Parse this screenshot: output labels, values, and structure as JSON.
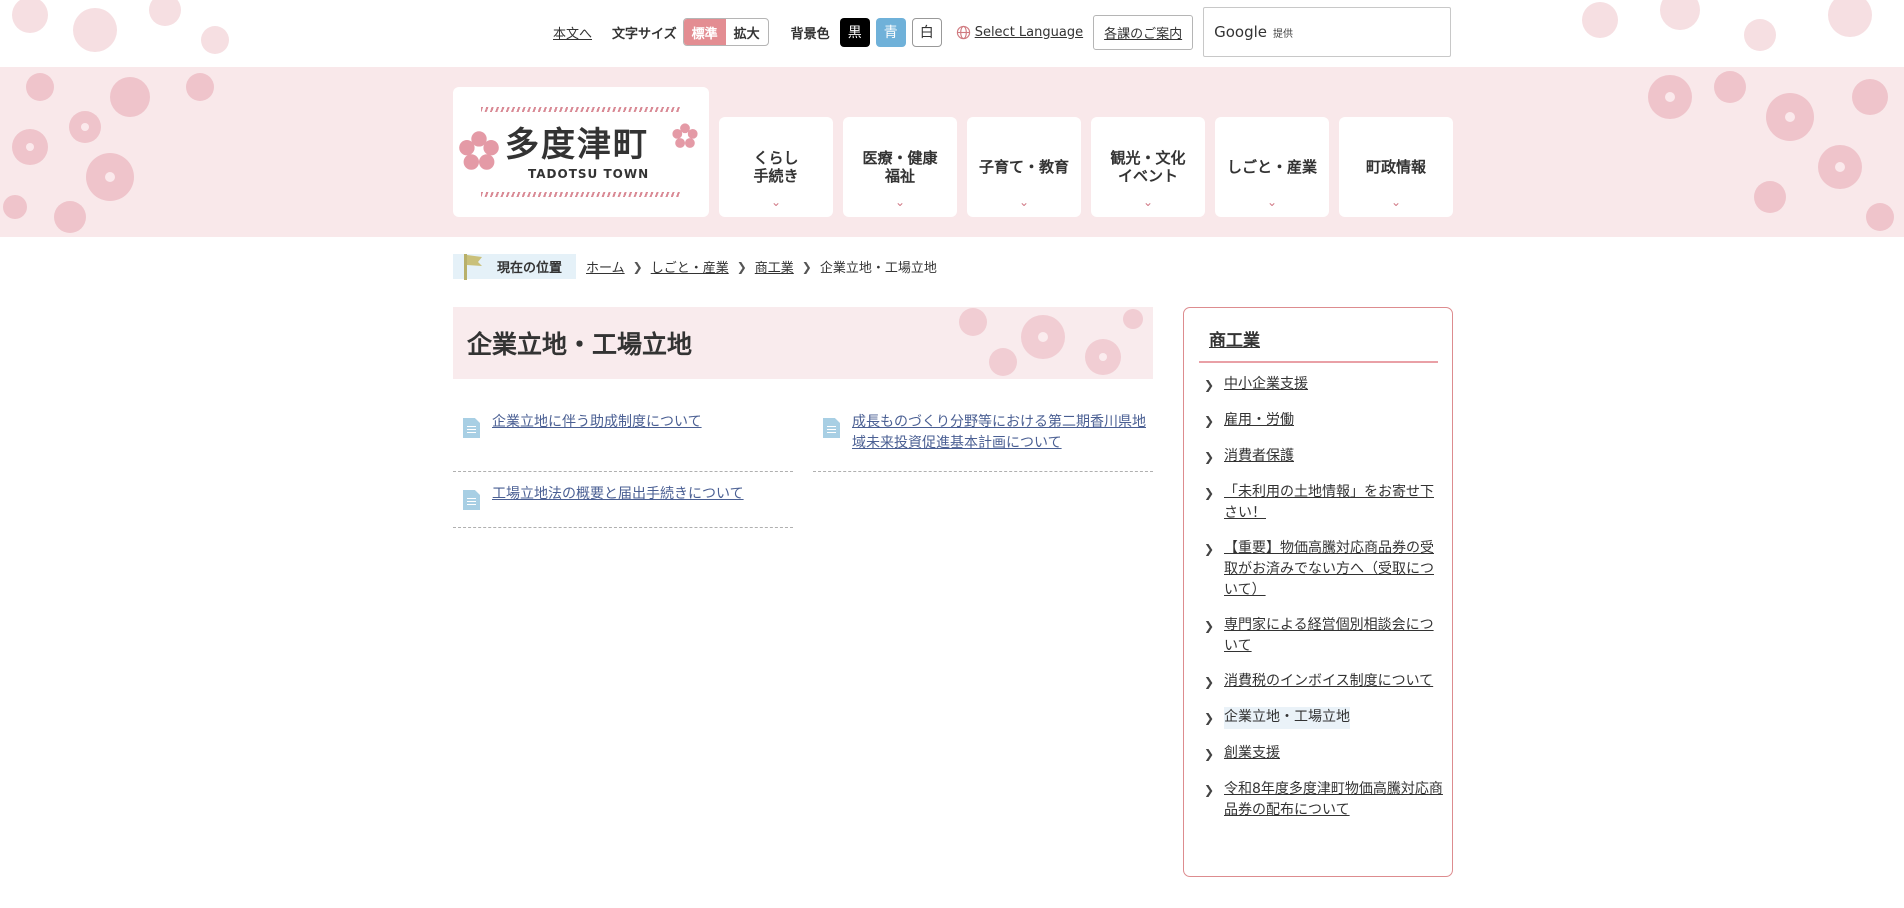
{
  "utility": {
    "skip_link": "本文へ",
    "font_size_label": "文字サイズ",
    "font_standard": "標準",
    "font_large": "拡大",
    "bg_label": "背景色",
    "bg_black": "黒",
    "bg_blue": "青",
    "bg_white": "白",
    "language": "Select Language",
    "department_guide": "各課のご案内",
    "search_brand": "Google",
    "search_provided": "提供"
  },
  "logo": {
    "title": "多度津町",
    "subtitle": "TADOTSU TOWN"
  },
  "nav": [
    {
      "label": "くらし\n手続き"
    },
    {
      "label": "医療・健康\n福祉"
    },
    {
      "label": "子育て・教育"
    },
    {
      "label": "観光・文化\nイベント"
    },
    {
      "label": "しごと・産業"
    },
    {
      "label": "町政情報"
    }
  ],
  "breadcrumb": {
    "label": "現在の位置",
    "items": [
      "ホーム",
      "しごと・産業",
      "商工業"
    ],
    "current": "企業立地・工場立地"
  },
  "page": {
    "title": "企業立地・工場立地",
    "links": [
      "企業立地に伴う助成制度について",
      "成長ものづくり分野等における第二期香川県地域未来投資促進基本計画について",
      "工場立地法の概要と届出手続きについて"
    ]
  },
  "sidebar": {
    "title": "商工業",
    "items": [
      "中小企業支援",
      "雇用・労働",
      "消費者保護",
      "「未利用の土地情報」をお寄せ下さい！",
      "【重要】物価高騰対応商品券の受取がお済みでない方へ（受取について）",
      "専門家による経営個別相談会について",
      "消費税のインボイス制度について",
      "企業立地・工場立地",
      "創業支援",
      "令和8年度多度津町物価高騰対応商品券の配布について"
    ]
  },
  "colors": {
    "accent_pink": "#e38d92",
    "header_bg": "#f9e8ea",
    "link_blue": "#4a5f93",
    "breadcrumb_bg": "#e5f1f8"
  }
}
